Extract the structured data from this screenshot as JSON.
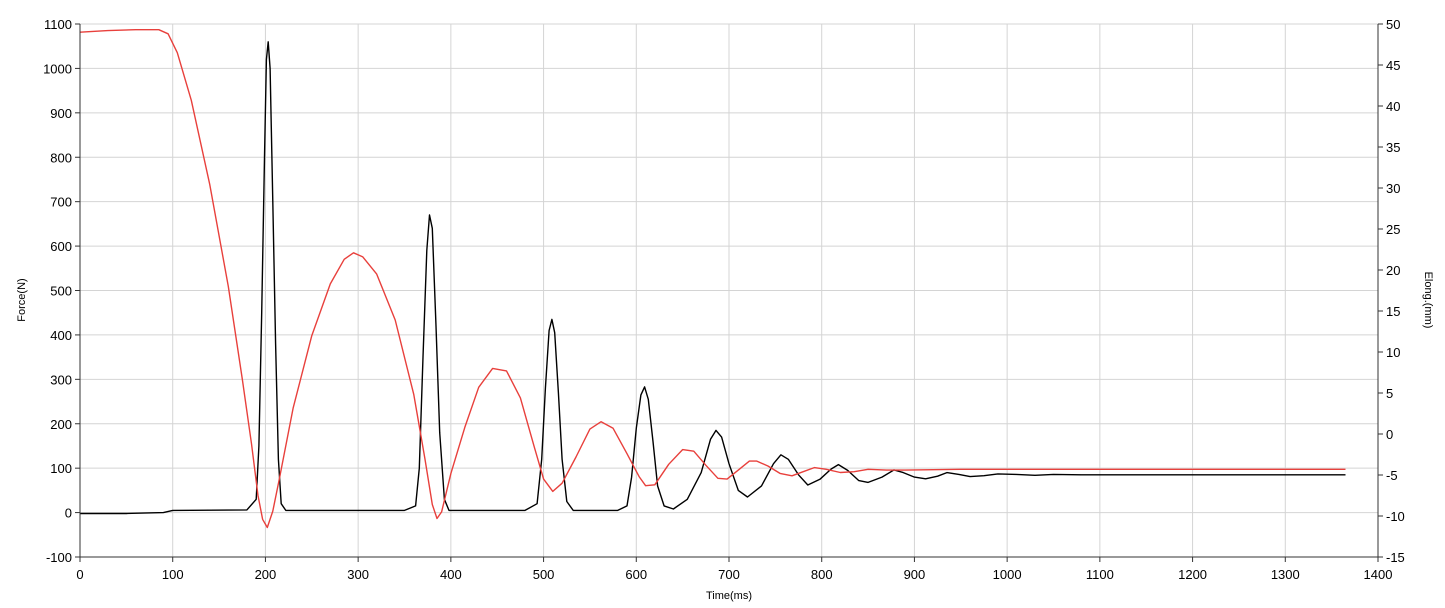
{
  "chart_data": {
    "type": "line",
    "xlabel": "Time(ms)",
    "ylabel_left": "Force(N)",
    "ylabel_right": "Elong.(mm)",
    "xlim": [
      0,
      1400
    ],
    "ylim_left": [
      -100,
      1100
    ],
    "ylim_right": [
      -15,
      50
    ],
    "grid": true,
    "x_ticks": [
      "0",
      "100",
      "200",
      "300",
      "400",
      "500",
      "600",
      "700",
      "800",
      "900",
      "1000",
      "1100",
      "1200",
      "1300",
      "1400"
    ],
    "y_left_ticks": [
      "-100",
      "0",
      "100",
      "200",
      "300",
      "400",
      "500",
      "600",
      "700",
      "800",
      "900",
      "1000",
      "1100"
    ],
    "y_right_ticks": [
      "-15",
      "-10",
      "-5",
      "0",
      "5",
      "10",
      "15",
      "20",
      "25",
      "30",
      "35",
      "40",
      "45",
      "50"
    ],
    "series": [
      {
        "axis": "left",
        "color": "#000000",
        "points": [
          [
            0,
            -2
          ],
          [
            50,
            -2
          ],
          [
            90,
            0
          ],
          [
            100,
            5
          ],
          [
            180,
            6
          ],
          [
            190,
            30
          ],
          [
            193,
            150
          ],
          [
            196,
            450
          ],
          [
            199,
            800
          ],
          [
            201,
            1020
          ],
          [
            203,
            1060
          ],
          [
            205,
            1000
          ],
          [
            208,
            700
          ],
          [
            211,
            380
          ],
          [
            214,
            120
          ],
          [
            217,
            20
          ],
          [
            222,
            5
          ],
          [
            300,
            5
          ],
          [
            350,
            5
          ],
          [
            362,
            15
          ],
          [
            366,
            100
          ],
          [
            370,
            350
          ],
          [
            374,
            590
          ],
          [
            377,
            670
          ],
          [
            380,
            640
          ],
          [
            384,
            420
          ],
          [
            388,
            180
          ],
          [
            393,
            30
          ],
          [
            398,
            5
          ],
          [
            480,
            5
          ],
          [
            493,
            20
          ],
          [
            498,
            120
          ],
          [
            502,
            280
          ],
          [
            506,
            410
          ],
          [
            509,
            435
          ],
          [
            512,
            405
          ],
          [
            516,
            270
          ],
          [
            520,
            120
          ],
          [
            525,
            25
          ],
          [
            532,
            5
          ],
          [
            580,
            5
          ],
          [
            590,
            15
          ],
          [
            595,
            80
          ],
          [
            600,
            190
          ],
          [
            605,
            265
          ],
          [
            609,
            283
          ],
          [
            613,
            255
          ],
          [
            618,
            160
          ],
          [
            623,
            60
          ],
          [
            630,
            15
          ],
          [
            640,
            8
          ],
          [
            655,
            30
          ],
          [
            670,
            90
          ],
          [
            680,
            165
          ],
          [
            686,
            185
          ],
          [
            692,
            170
          ],
          [
            700,
            110
          ],
          [
            710,
            50
          ],
          [
            720,
            35
          ],
          [
            735,
            60
          ],
          [
            748,
            110
          ],
          [
            756,
            130
          ],
          [
            764,
            120
          ],
          [
            775,
            85
          ],
          [
            785,
            62
          ],
          [
            798,
            75
          ],
          [
            810,
            98
          ],
          [
            818,
            108
          ],
          [
            828,
            95
          ],
          [
            840,
            72
          ],
          [
            850,
            68
          ],
          [
            865,
            80
          ],
          [
            878,
            96
          ],
          [
            888,
            90
          ],
          [
            900,
            80
          ],
          [
            912,
            76
          ],
          [
            925,
            82
          ],
          [
            935,
            90
          ],
          [
            948,
            86
          ],
          [
            960,
            81
          ],
          [
            975,
            83
          ],
          [
            990,
            87
          ],
          [
            1010,
            86
          ],
          [
            1030,
            84
          ],
          [
            1050,
            86
          ],
          [
            1080,
            85
          ],
          [
            1150,
            85
          ],
          [
            1250,
            85
          ],
          [
            1300,
            85
          ],
          [
            1365,
            85
          ]
        ]
      },
      {
        "axis": "right",
        "color": "#e8403c",
        "points": [
          [
            0,
            49.0
          ],
          [
            30,
            49.2
          ],
          [
            60,
            49.3
          ],
          [
            85,
            49.3
          ],
          [
            95,
            48.8
          ],
          [
            105,
            46.5
          ],
          [
            120,
            40.7
          ],
          [
            140,
            30.4
          ],
          [
            160,
            18.0
          ],
          [
            175,
            6.7
          ],
          [
            185,
            -1.2
          ],
          [
            192,
            -7.5
          ],
          [
            197,
            -10.4
          ],
          [
            202,
            -11.4
          ],
          [
            208,
            -9.4
          ],
          [
            215,
            -5.5
          ],
          [
            230,
            3.2
          ],
          [
            250,
            12.0
          ],
          [
            270,
            18.3
          ],
          [
            285,
            21.3
          ],
          [
            295,
            22.1
          ],
          [
            305,
            21.6
          ],
          [
            320,
            19.5
          ],
          [
            340,
            13.9
          ],
          [
            360,
            4.8
          ],
          [
            372,
            -3.0
          ],
          [
            380,
            -8.6
          ],
          [
            385,
            -10.3
          ],
          [
            390,
            -9.5
          ],
          [
            400,
            -4.8
          ],
          [
            415,
            0.8
          ],
          [
            430,
            5.7
          ],
          [
            445,
            8.0
          ],
          [
            460,
            7.7
          ],
          [
            475,
            4.4
          ],
          [
            490,
            -1.6
          ],
          [
            500,
            -5.5
          ],
          [
            510,
            -7.0
          ],
          [
            520,
            -6.0
          ],
          [
            535,
            -2.8
          ],
          [
            550,
            0.6
          ],
          [
            562,
            1.5
          ],
          [
            575,
            0.7
          ],
          [
            590,
            -2.4
          ],
          [
            603,
            -5.2
          ],
          [
            610,
            -6.3
          ],
          [
            620,
            -6.2
          ],
          [
            635,
            -3.7
          ],
          [
            650,
            -1.9
          ],
          [
            662,
            -2.1
          ],
          [
            675,
            -3.8
          ],
          [
            688,
            -5.4
          ],
          [
            698,
            -5.5
          ],
          [
            710,
            -4.4
          ],
          [
            722,
            -3.3
          ],
          [
            730,
            -3.3
          ],
          [
            742,
            -3.9
          ],
          [
            755,
            -4.8
          ],
          [
            768,
            -5.1
          ],
          [
            780,
            -4.6
          ],
          [
            792,
            -4.1
          ],
          [
            805,
            -4.3
          ],
          [
            820,
            -4.7
          ],
          [
            835,
            -4.6
          ],
          [
            850,
            -4.3
          ],
          [
            870,
            -4.4
          ],
          [
            890,
            -4.4
          ],
          [
            950,
            -4.3
          ],
          [
            1000,
            -4.3
          ],
          [
            1100,
            -4.3
          ],
          [
            1200,
            -4.3
          ],
          [
            1300,
            -4.3
          ],
          [
            1365,
            -4.3
          ]
        ]
      }
    ]
  }
}
